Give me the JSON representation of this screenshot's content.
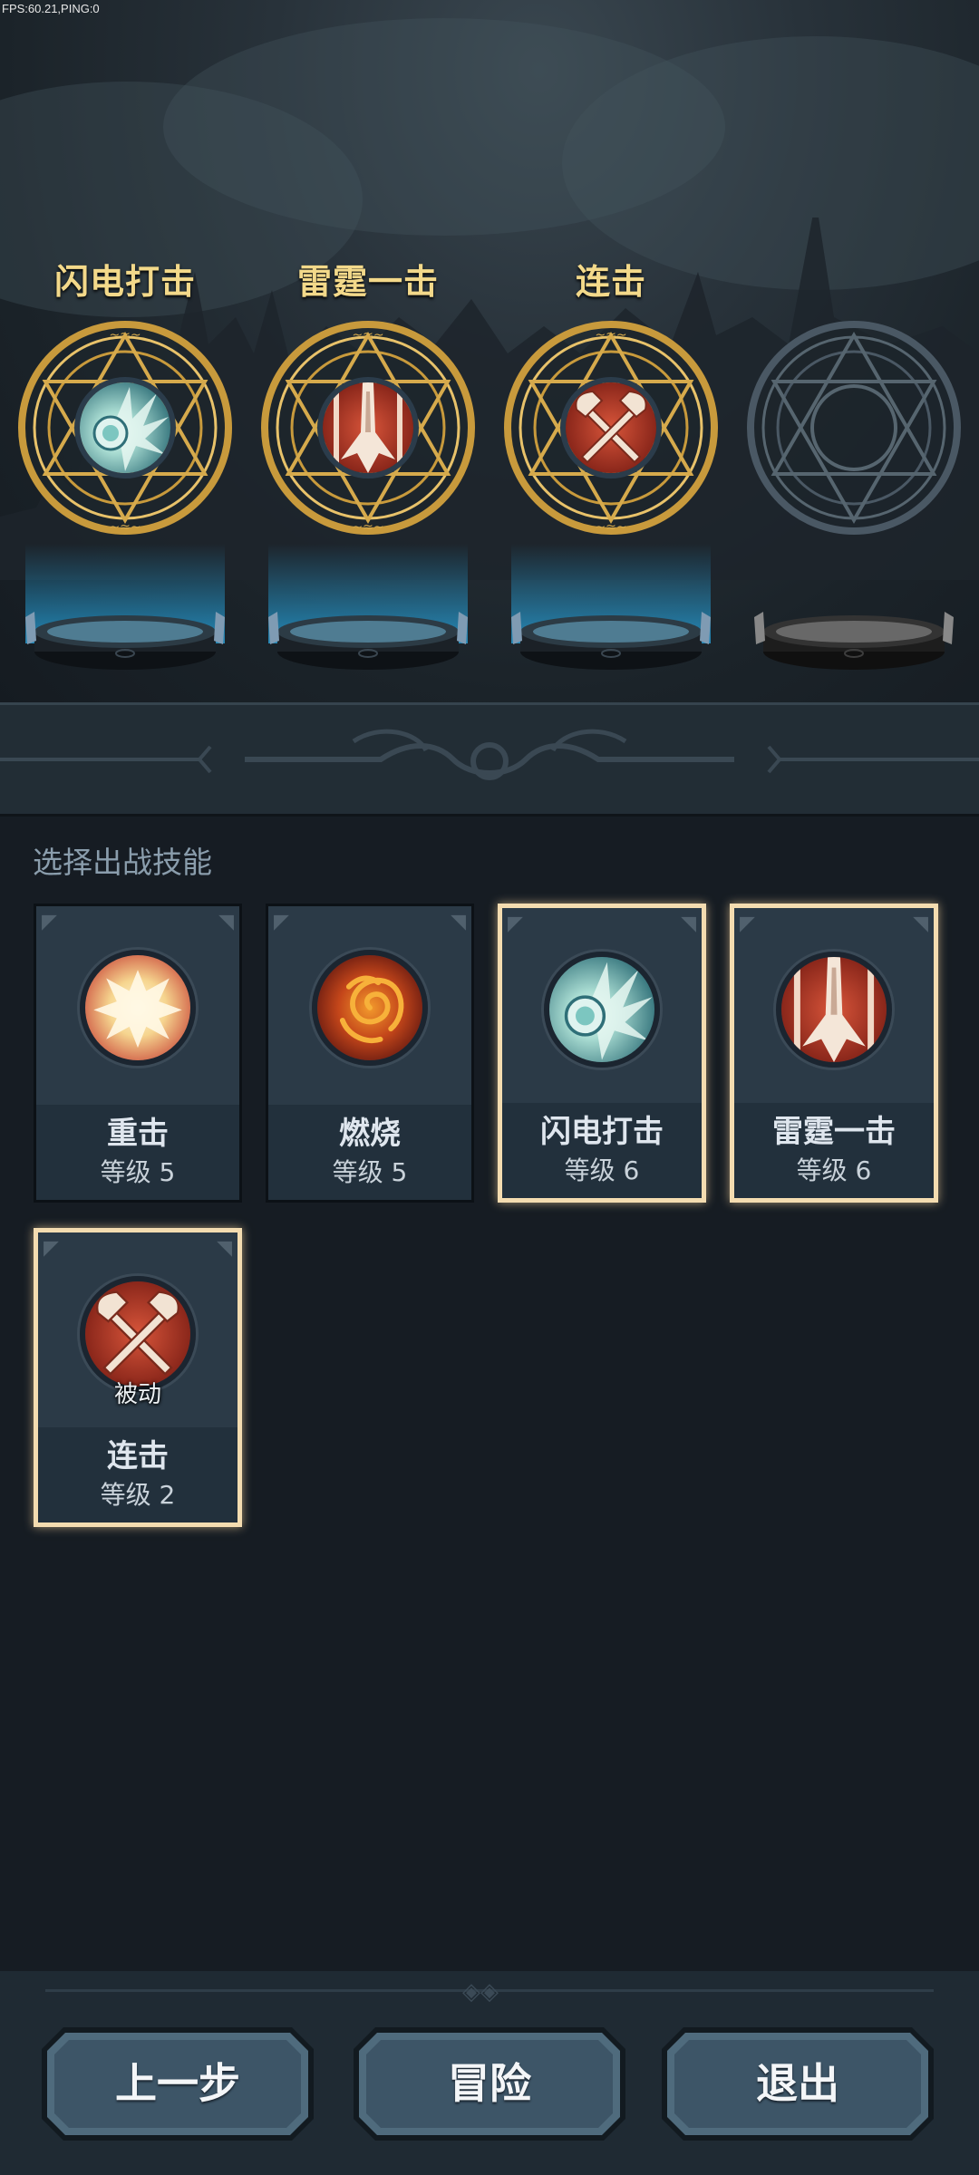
{
  "debug": {
    "fps_text": "FPS:60.21,PING:0"
  },
  "slots": [
    {
      "title": "闪电打击",
      "skill": "lightning-strike",
      "filled": true
    },
    {
      "title": "雷霆一击",
      "skill": "thunder-strike",
      "filled": true
    },
    {
      "title": "连击",
      "skill": "combo",
      "filled": true
    },
    {
      "title": "",
      "skill": "",
      "filled": false
    }
  ],
  "skill_section": {
    "title": "选择出战技能"
  },
  "skills": [
    {
      "name": "重击",
      "level": "等级 5",
      "icon": "heavy-strike-icon",
      "selected": false,
      "passive_label": ""
    },
    {
      "name": "燃烧",
      "level": "等级 5",
      "icon": "burn-icon",
      "selected": false,
      "passive_label": ""
    },
    {
      "name": "闪电打击",
      "level": "等级 6",
      "icon": "lightning-strike-icon",
      "selected": true,
      "passive_label": ""
    },
    {
      "name": "雷霆一击",
      "level": "等级 6",
      "icon": "thunder-strike-icon",
      "selected": true,
      "passive_label": ""
    },
    {
      "name": "连击",
      "level": "等级 2",
      "icon": "combo-axes-icon",
      "selected": true,
      "passive_label": "被动"
    }
  ],
  "buttons": {
    "back": "上一步",
    "adventure": "冒险",
    "exit": "退出"
  },
  "colors": {
    "gold_title": "#f3d98a",
    "selected_border": "#f4dcb0",
    "button_face": "#3d5567"
  }
}
